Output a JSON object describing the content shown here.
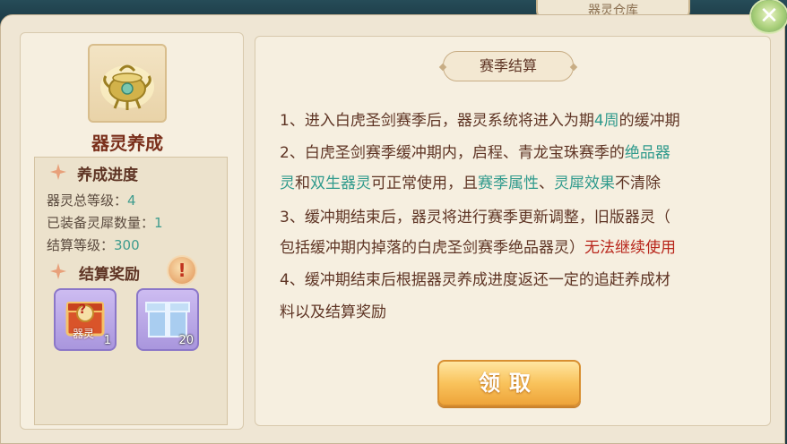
{
  "top_tab": {
    "label": "器灵仓库"
  },
  "close": {
    "glyph": "✕"
  },
  "left": {
    "title": "器灵养成",
    "progress": {
      "heading": "养成进度",
      "stats": [
        {
          "label": "器灵总等级：",
          "value": "4"
        },
        {
          "label": "已装备灵犀数量：",
          "value": "1"
        },
        {
          "label": "结算等级：",
          "value": "300"
        }
      ]
    },
    "rewards": {
      "heading": "结算奖励",
      "warn_glyph": "!",
      "items": [
        {
          "icon": "mystery-chest-icon",
          "tag": "器灵",
          "badge": "?",
          "count": "1"
        },
        {
          "icon": "gift-box-icon",
          "count": "20"
        }
      ]
    }
  },
  "right": {
    "title": "赛季结算",
    "rules": {
      "r1a": "1、进入白虎圣剑赛季后，器灵系统将进入为期",
      "r1b": "4周",
      "r1c": "的缓冲期",
      "r2a": "2、白虎圣剑赛季缓冲期内，启程、青龙宝珠赛季的",
      "r2b": "绝品器",
      "r2c": "灵",
      "r2d": "和",
      "r2e": "双生器灵",
      "r2f": "可正常使用，且",
      "r2g": "赛季属性",
      "r2h": "、",
      "r2i": "灵犀效果",
      "r2j": "不清除",
      "r3a": "3、缓冲期结束后，器灵将进行赛季更新调整，旧版器灵（",
      "r3b": "包括缓冲期内掉落的白虎圣剑赛季绝品器灵）",
      "r3c": "无法继续使用",
      "r4a": "4、缓冲期结束后根据器灵养成进度返还一定的追赶养成材",
      "r4b": "料以及结算奖励"
    },
    "claim_label": "领取"
  },
  "colors": {
    "accent_teal": "#2f9a8c",
    "warning_red": "#b8261b",
    "title_brown": "#7a2f1b"
  }
}
